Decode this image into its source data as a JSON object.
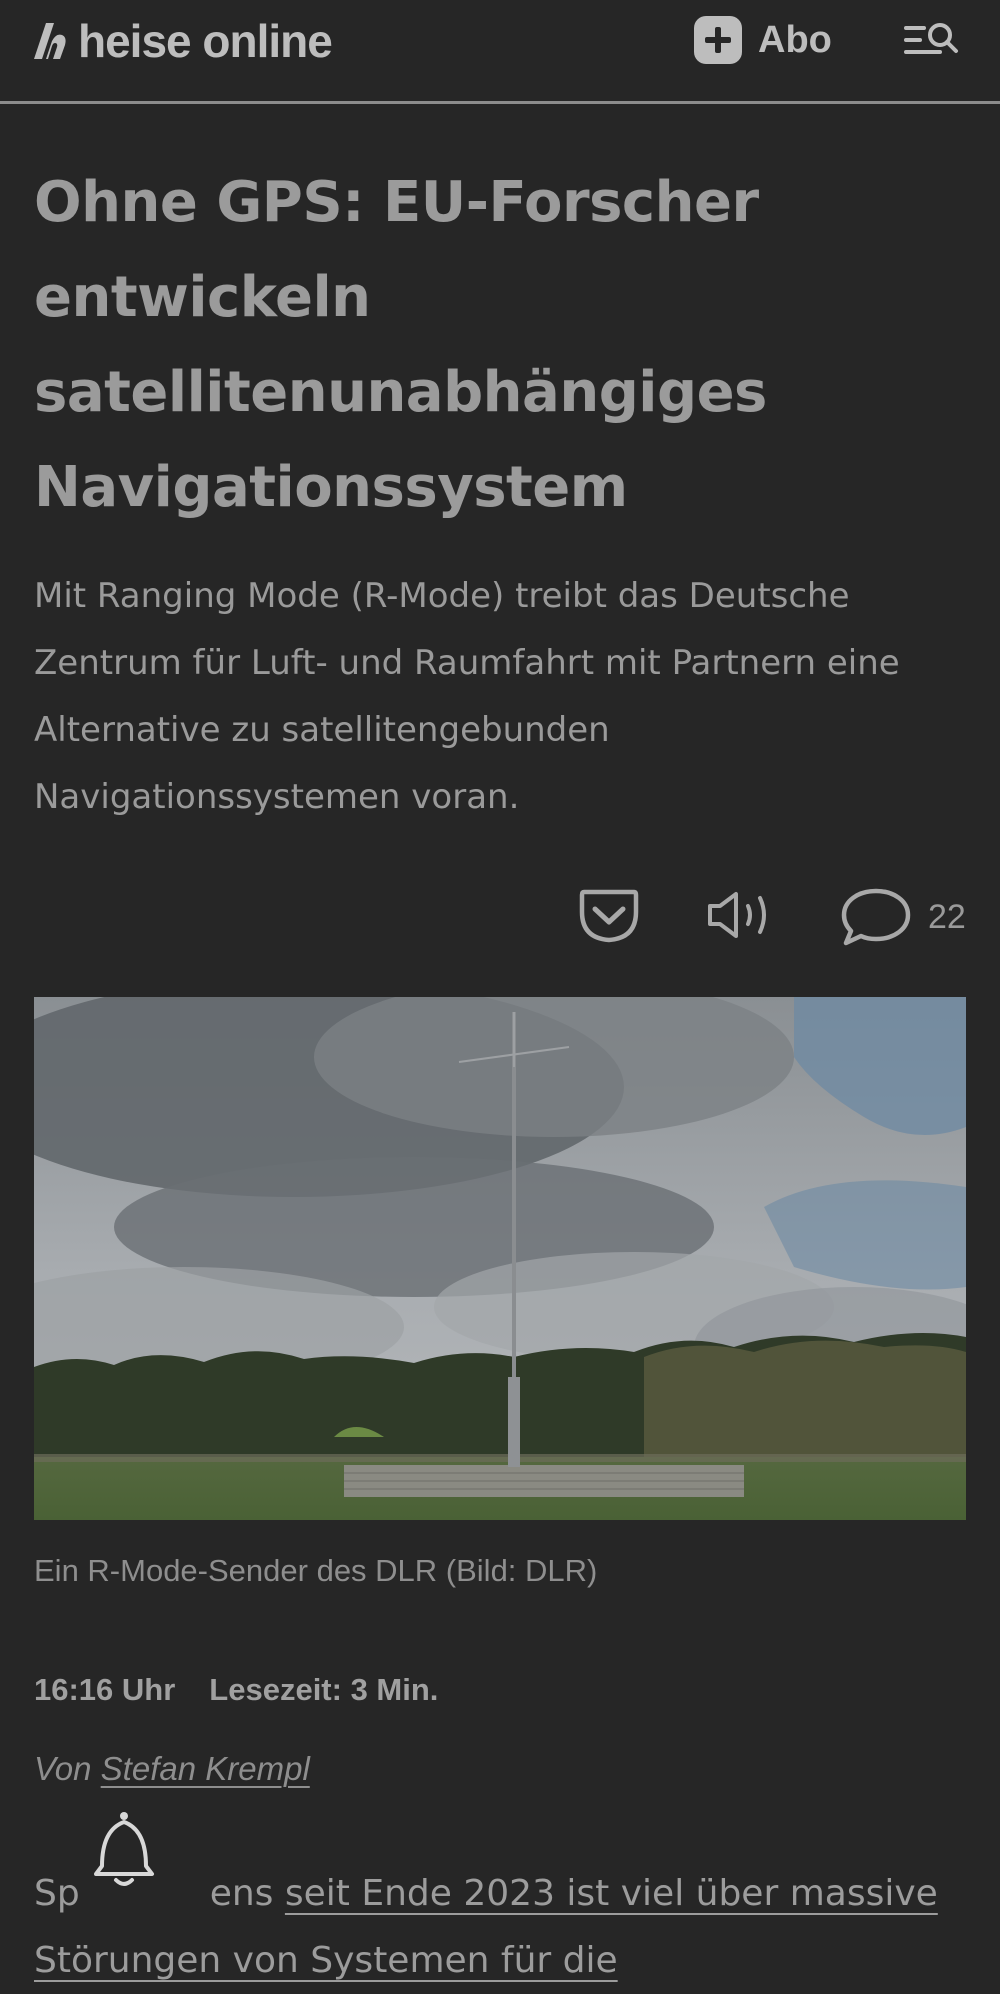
{
  "header": {
    "logo_text": "heise online",
    "abo_label": "Abo",
    "menu_icon": "menu-search-icon"
  },
  "article": {
    "headline": "Ohne GPS: EU-Forscher entwickeln satellitenunabhängiges Navigationssystem",
    "teaser": "Mit Ranging Mode (R-Mode) treibt das Deutsche Zentrum für Luft- und Raumfahrt mit Partnern eine Alternative zu satellitengebunden Navigationssystemen voran.",
    "comment_count": "22",
    "image_caption": "Ein R-Mode-Sender des DLR (Bild: DLR)",
    "time": "16:16 Uhr",
    "reading_time": "Lesezeit: 3 Min.",
    "byline_prefix": "Von",
    "author": "Stefan Krempl",
    "body_start": "Sp",
    "body_mid": "ens",
    "body_link": "seit Ende 2023 ist viel über massive Störungen von Systemen für die",
    "icons": [
      "pocket-icon",
      "speaker-icon",
      "comment-icon",
      "bell-icon"
    ]
  }
}
